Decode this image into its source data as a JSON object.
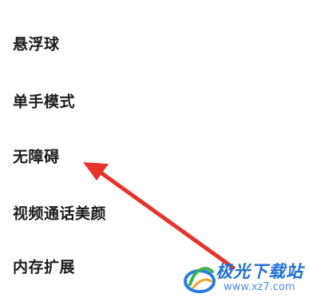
{
  "settings": {
    "items": [
      {
        "label": "悬浮球"
      },
      {
        "label": "单手模式"
      },
      {
        "label": "无障碍"
      },
      {
        "label": "视频通话美颜"
      },
      {
        "label": "内存扩展"
      }
    ]
  },
  "annotation": {
    "arrow_color": "#e8322a",
    "points_to": "无障碍"
  },
  "watermark": {
    "site_name": "极光下载站",
    "url": "www.xz7.com",
    "logo_icon": "aurora-swirl-logo",
    "brand_color": "#1f6fd6"
  }
}
